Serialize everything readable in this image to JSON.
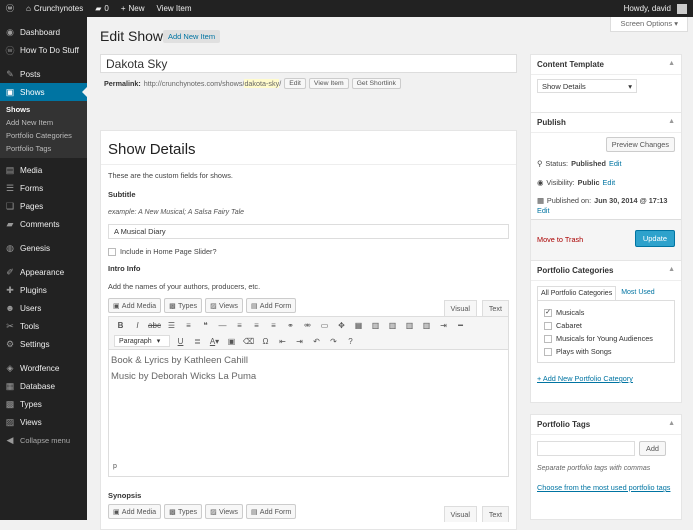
{
  "adminbar": {
    "site": "Crunchynotes",
    "comments": "0",
    "new": "New",
    "view": "View Item",
    "howdy": "Howdy, david"
  },
  "menu": {
    "items": [
      {
        "label": "Dashboard",
        "icon": "dashboard-icon",
        "glyph": "◉"
      },
      {
        "label": "How To Do Stuff",
        "icon": "wordpress-icon",
        "glyph": "ⓦ"
      },
      {
        "label": "Posts",
        "icon": "pin-icon",
        "glyph": "✎"
      },
      {
        "label": "Shows",
        "icon": "media-icon",
        "glyph": "▣"
      },
      {
        "label": "Media",
        "icon": "camera-icon",
        "glyph": "▤"
      },
      {
        "label": "Forms",
        "icon": "forms-icon",
        "glyph": "☰"
      },
      {
        "label": "Pages",
        "icon": "page-icon",
        "glyph": "❑"
      },
      {
        "label": "Comments",
        "icon": "comment-icon",
        "glyph": "▰"
      },
      {
        "label": "Genesis",
        "icon": "genesis-icon",
        "glyph": "◍"
      },
      {
        "label": "Appearance",
        "icon": "brush-icon",
        "glyph": "✐"
      },
      {
        "label": "Plugins",
        "icon": "plugin-icon",
        "glyph": "✚"
      },
      {
        "label": "Users",
        "icon": "users-icon",
        "glyph": "☻"
      },
      {
        "label": "Tools",
        "icon": "wrench-icon",
        "glyph": "✂"
      },
      {
        "label": "Settings",
        "icon": "settings-icon",
        "glyph": "⚙"
      },
      {
        "label": "Wordfence",
        "icon": "wordfence-icon",
        "glyph": "◈"
      },
      {
        "label": "Database",
        "icon": "database-icon",
        "glyph": "▦"
      },
      {
        "label": "Types",
        "icon": "types-icon",
        "glyph": "▩"
      },
      {
        "label": "Views",
        "icon": "views-icon",
        "glyph": "▨"
      },
      {
        "label": "Collapse menu",
        "icon": "collapse-icon",
        "glyph": "◀"
      }
    ],
    "submenu": [
      "Shows",
      "Add New Item",
      "Portfolio Categories",
      "Portfolio Tags"
    ]
  },
  "screen_options": "Screen Options ▾",
  "page_title": "Edit Show",
  "add_new": "Add New Item",
  "post_title": "Dakota Sky",
  "permalink": {
    "label": "Permalink:",
    "base": "http://crunchynotes.com/shows/",
    "slug": "dakota-sky",
    "end": "/",
    "edit": "Edit",
    "view": "View Item",
    "shortlink": "Get Shortlink"
  },
  "show_details": {
    "title": "Show Details",
    "desc": "These are the custom fields for shows.",
    "subtitle_label": "Subtitle",
    "subtitle_example": "example: A New Musical; A Salsa Fairy Tale",
    "subtitle_value": "A Musical Diary",
    "slider_label": "Include in Home Page Slider?",
    "intro_label": "Intro Info",
    "intro_desc": "Add the names of your authors, producers, etc.",
    "toolbar": [
      "Add Media",
      "Types",
      "Views",
      "Add Form"
    ],
    "tab_visual": "Visual",
    "tab_text": "Text",
    "format": "Paragraph",
    "content": [
      "Book & Lyrics by Kathleen Cahill",
      "Music by Deborah Wicks La Puma"
    ],
    "path": "p",
    "synopsis_label": "Synopsis"
  },
  "template_box": {
    "title": "Content Template",
    "selected": "Show Details"
  },
  "publish": {
    "title": "Publish",
    "preview": "Preview Changes",
    "status_label": "Status:",
    "status": "Published",
    "visibility_label": "Visibility:",
    "visibility": "Public",
    "published_label": "Published on:",
    "published": "Jun 30, 2014 @ 17:13",
    "edit": "Edit",
    "trash": "Move to Trash",
    "update": "Update"
  },
  "categories": {
    "title": "Portfolio Categories",
    "tab_all": "All Portfolio Categories",
    "tab_used": "Most Used",
    "items": [
      {
        "label": "Musicals",
        "checked": "✓"
      },
      {
        "label": "Cabaret",
        "checked": ""
      },
      {
        "label": "Musicals for Young Audiences",
        "checked": ""
      },
      {
        "label": "Plays with Songs",
        "checked": ""
      }
    ],
    "add": "+ Add New Portfolio Category"
  },
  "tags": {
    "title": "Portfolio Tags",
    "add": "Add",
    "hint": "Separate portfolio tags with commas",
    "choose": "Choose from the most used portfolio tags"
  }
}
